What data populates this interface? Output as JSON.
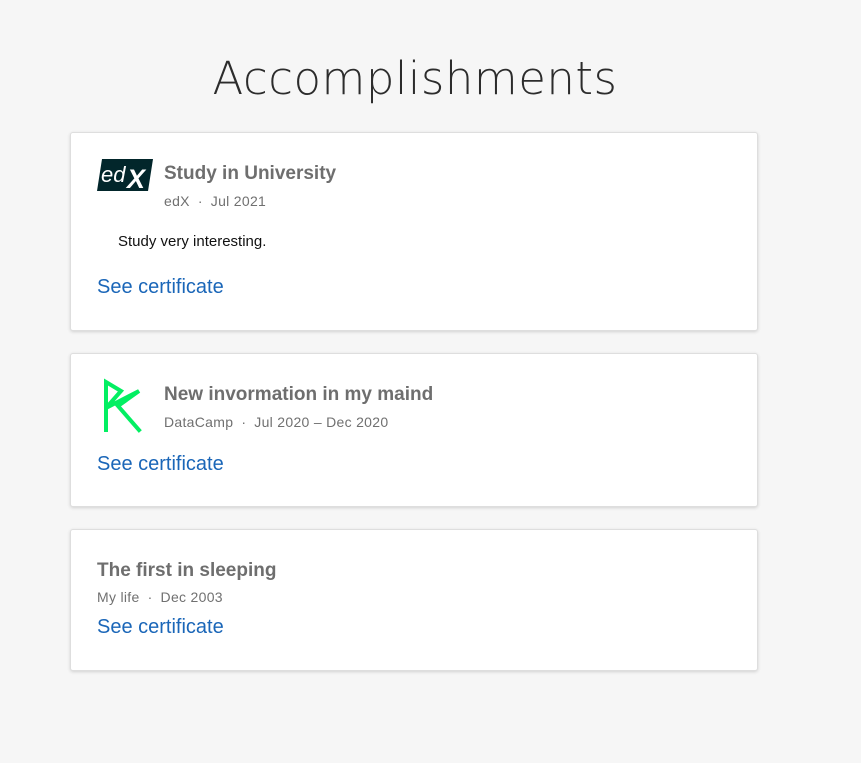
{
  "page": {
    "title": "Accomplishments"
  },
  "accomplishments": [
    {
      "title": "Study in University",
      "issuer": "edX",
      "date": "Jul 2021",
      "description": "Study very interesting.",
      "link_label": "See certificate",
      "logo": "edx-logo"
    },
    {
      "title": "New invormation in my maind",
      "issuer": "DataCamp",
      "date": "Jul 2020 – Dec 2020",
      "link_label": "See certificate",
      "logo": "datacamp-logo"
    },
    {
      "title": "The first in sleeping",
      "issuer": "My life",
      "date": "Dec 2003",
      "link_label": "See certificate"
    }
  ],
  "meta_separator": "·",
  "colors": {
    "background": "#f6f6f6",
    "link": "#1a66b8",
    "title": "#6e6e6e",
    "edx_brand": "#02262b",
    "datacamp_brand": "#03ef62"
  }
}
